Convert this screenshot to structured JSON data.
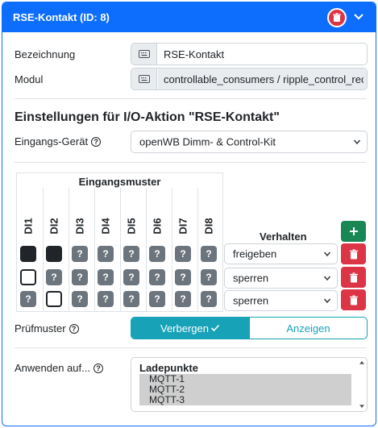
{
  "header": {
    "title": "RSE-Kontakt (ID: 8)",
    "colors": {
      "header_bg": "#0d6efd",
      "danger": "#dc3545",
      "success": "#198754",
      "info": "#17a2b8"
    },
    "delete_icon": "trash-icon",
    "collapse_icon": "chevron-down-icon"
  },
  "fields": {
    "bezeichnung": {
      "label": "Bezeichnung",
      "value": "RSE-Kontakt",
      "icon": "keyboard-icon"
    },
    "modul": {
      "label": "Modul",
      "value": "controllable_consumers / ripple_control_receive",
      "icon": "keyboard-icon"
    }
  },
  "section": {
    "title": "Einstellungen für I/O-Aktion \"RSE-Kontakt\""
  },
  "eingangs_geraet": {
    "label": "Eingangs-Gerät",
    "selected": "openWB Dimm- & Control-Kit"
  },
  "pattern": {
    "title": "Eingangsmuster",
    "columns": [
      "DI1",
      "DI2",
      "DI3",
      "DI4",
      "DI5",
      "DI6",
      "DI7",
      "DI8"
    ],
    "any_symbol": "?",
    "rows": [
      [
        "on",
        "on",
        "any",
        "any",
        "any",
        "any",
        "any",
        "any"
      ],
      [
        "off",
        "any",
        "any",
        "any",
        "any",
        "any",
        "any",
        "any"
      ],
      [
        "any",
        "off",
        "any",
        "any",
        "any",
        "any",
        "any",
        "any"
      ]
    ]
  },
  "verhalten": {
    "title": "Verhalten",
    "rows": [
      "freigeben",
      "sperren",
      "sperren"
    ]
  },
  "pruefmuster": {
    "label": "Prüfmuster",
    "hide_label": "Verbergen",
    "show_label": "Anzeigen",
    "selected": "Verbergen"
  },
  "anwenden": {
    "label": "Anwenden auf...",
    "group": "Ladepunkte",
    "items": [
      "MQTT-1",
      "MQTT-2",
      "MQTT-3"
    ]
  }
}
